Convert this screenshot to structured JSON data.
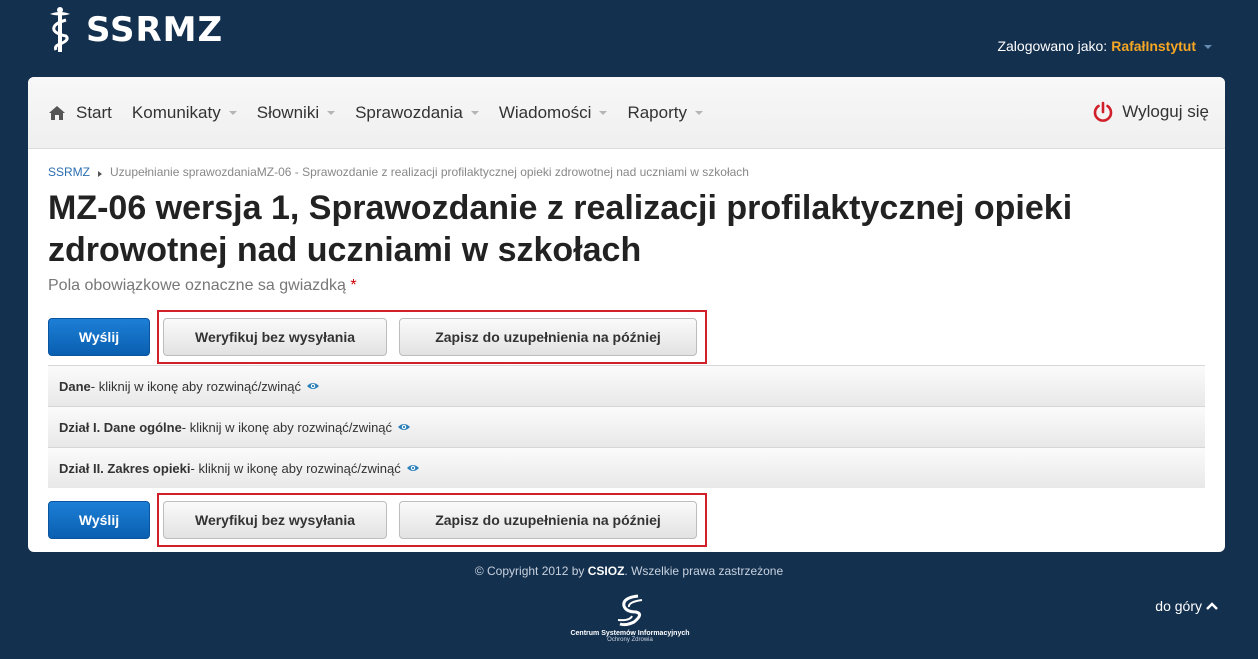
{
  "header": {
    "logo_text": "SSRMZ",
    "login_label": "Zalogowano jako:",
    "login_user": "RafałInstytut"
  },
  "nav": {
    "items": [
      {
        "label": "Start"
      },
      {
        "label": "Komunikaty"
      },
      {
        "label": "Słowniki"
      },
      {
        "label": "Sprawozdania"
      },
      {
        "label": "Wiadomości"
      },
      {
        "label": "Raporty"
      }
    ],
    "logout_label": "Wyloguj się"
  },
  "breadcrumb": {
    "root": "SSRMZ",
    "current": "Uzupełnianie sprawozdaniaMZ-06 - Sprawozdanie z realizacji profilaktycznej opieki zdrowotnej nad uczniami w szkołach"
  },
  "page": {
    "title": "MZ-06 wersja 1, Sprawozdanie z realizacji profilaktycznej opieki zdrowotnej nad uczniami w szkołach",
    "required_note": "Pola obowiązkowe oznaczne sa gwiazdką",
    "required_star": "*"
  },
  "buttons": {
    "send": "Wyślij",
    "verify": "Weryfikuj bez wysyłania",
    "save": "Zapisz do uzupełnienia na później"
  },
  "sections": [
    {
      "title": "Dane",
      "hint": " - kliknij w ikonę aby rozwinąć/zwinąć"
    },
    {
      "title": "Dział I. Dane ogólne",
      "hint": " - kliknij w ikonę aby rozwinąć/zwinąć"
    },
    {
      "title": "Dział II. Zakres opieki",
      "hint": " - kliknij w ikonę aby rozwinąć/zwinąć"
    }
  ],
  "footer": {
    "copyright_prefix": "© Copyright 2012 by ",
    "copyright_org": "CSIOZ",
    "copyright_suffix": ". Wszelkie prawa zastrzeżone",
    "logo_name": "Centrum Systemów Informacyjnych",
    "logo_sub": "Ochrony Zdrowia",
    "to_top": "do góry"
  },
  "colors": {
    "background": "#14304f",
    "primary_button": "#0a5fb0",
    "highlight_border": "#d0202a",
    "user_accent": "#f5a623",
    "logout_icon": "#d0202a"
  },
  "icons": [
    "caduceus-icon",
    "home-icon",
    "power-icon",
    "eye-icon",
    "chevron-up-icon",
    "csioz-logo-icon"
  ]
}
